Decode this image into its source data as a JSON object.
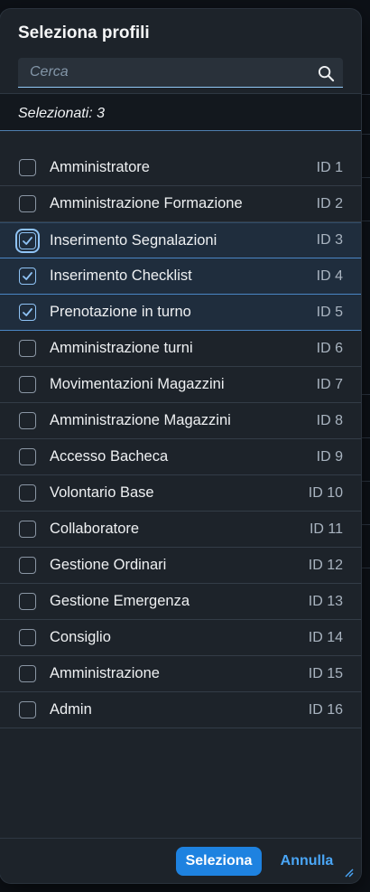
{
  "dialog": {
    "title": "Seleziona profili",
    "search": {
      "placeholder": "Cerca",
      "value": ""
    },
    "info": "Selezionati: 3",
    "items": [
      {
        "label": "Amministratore",
        "id": "ID 1",
        "checked": false
      },
      {
        "label": "Amministrazione Formazione",
        "id": "ID 2",
        "checked": false
      },
      {
        "label": "Inserimento Segnalazioni",
        "id": "ID 3",
        "checked": true
      },
      {
        "label": "Inserimento Checklist",
        "id": "ID 4",
        "checked": true
      },
      {
        "label": "Prenotazione in turno",
        "id": "ID 5",
        "checked": true
      },
      {
        "label": "Amministrazione turni",
        "id": "ID 6",
        "checked": false
      },
      {
        "label": "Movimentazioni Magazzini",
        "id": "ID 7",
        "checked": false
      },
      {
        "label": "Amministrazione Magazzini",
        "id": "ID 8",
        "checked": false
      },
      {
        "label": "Accesso Bacheca",
        "id": "ID 9",
        "checked": false
      },
      {
        "label": "Volontario Base",
        "id": "ID 10",
        "checked": false
      },
      {
        "label": "Collaboratore",
        "id": "ID 11",
        "checked": false
      },
      {
        "label": "Gestione Ordinari",
        "id": "ID 12",
        "checked": false
      },
      {
        "label": "Gestione Emergenza",
        "id": "ID 13",
        "checked": false
      },
      {
        "label": "Consiglio",
        "id": "ID 14",
        "checked": false
      },
      {
        "label": "Amministrazione",
        "id": "ID 15",
        "checked": false
      },
      {
        "label": "Admin",
        "id": "ID 16",
        "checked": false
      }
    ],
    "buttons": {
      "select": "Seleziona",
      "cancel": "Annulla"
    }
  },
  "colors": {
    "accent": "#1e82e0",
    "link": "#4aa6f7",
    "surface": "#1d232a",
    "selected_row": "#1f2d3d"
  },
  "icons": {
    "search": "search-icon",
    "check": "check-icon",
    "resize": "resize-handle-icon"
  }
}
